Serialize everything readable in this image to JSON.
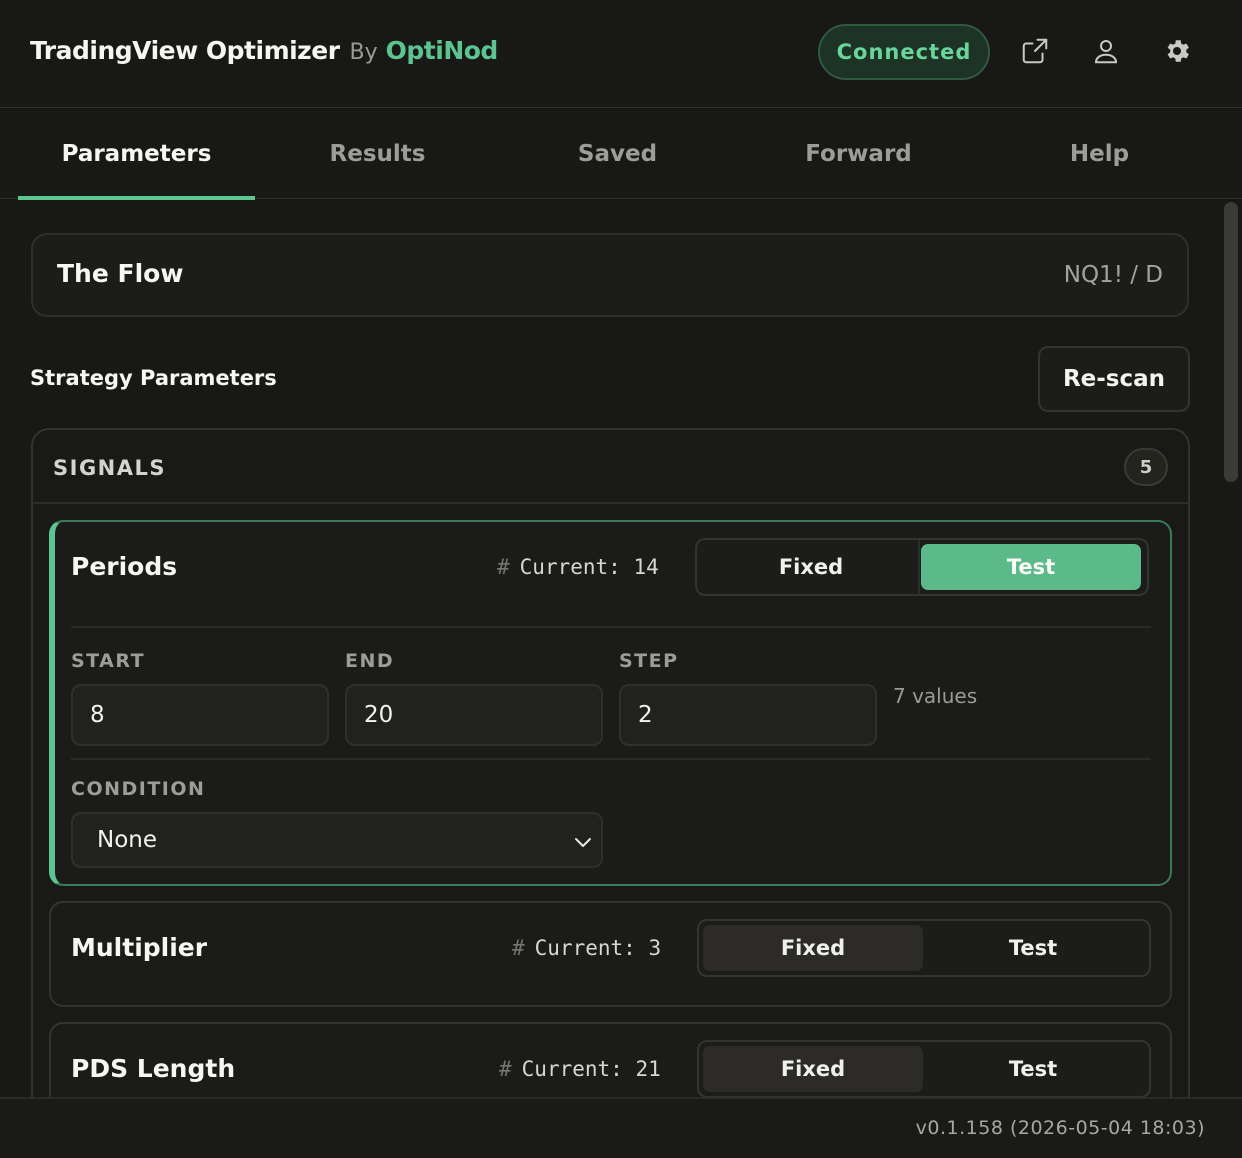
{
  "header": {
    "app_title": "TradingView Optimizer",
    "by_label": "By",
    "brand_name": "OptiNod",
    "status": "Connected",
    "icons": [
      "external-link-icon",
      "user-icon",
      "settings-gear-icon"
    ]
  },
  "tabs": [
    {
      "label": "Parameters",
      "active": true
    },
    {
      "label": "Results",
      "active": false
    },
    {
      "label": "Saved",
      "active": false
    },
    {
      "label": "Forward",
      "active": false
    },
    {
      "label": "Help",
      "active": false
    }
  ],
  "strategy": {
    "name": "The Flow",
    "symbol": "NQ1! / D"
  },
  "section": {
    "title": "Strategy Parameters",
    "rescan_label": "Re-scan"
  },
  "group": {
    "label": "SIGNALS",
    "count": "5"
  },
  "params": [
    {
      "name": "Periods",
      "hash": "#",
      "current": "Current: 14",
      "mode_fixed": "Fixed",
      "mode_test": "Test",
      "selected_mode": "Test",
      "start_label": "START",
      "end_label": "END",
      "step_label": "STEP",
      "start": "8",
      "end": "20",
      "step": "2",
      "values_count": "7 values",
      "condition_label": "CONDITION",
      "condition": "None"
    },
    {
      "name": "Multiplier",
      "hash": "#",
      "current": "Current: 3",
      "mode_fixed": "Fixed",
      "mode_test": "Test",
      "selected_mode": "Fixed"
    },
    {
      "name": "PDS Length",
      "hash": "#",
      "current": "Current: 21",
      "mode_fixed": "Fixed",
      "mode_test": "Test",
      "selected_mode": "Fixed"
    }
  ],
  "footer": {
    "version": "v0.1.158 (2026-05-04 18:03)"
  },
  "colors": {
    "accent": "#5cc58f",
    "background": "#181816",
    "status_bg": "#1c3326"
  }
}
